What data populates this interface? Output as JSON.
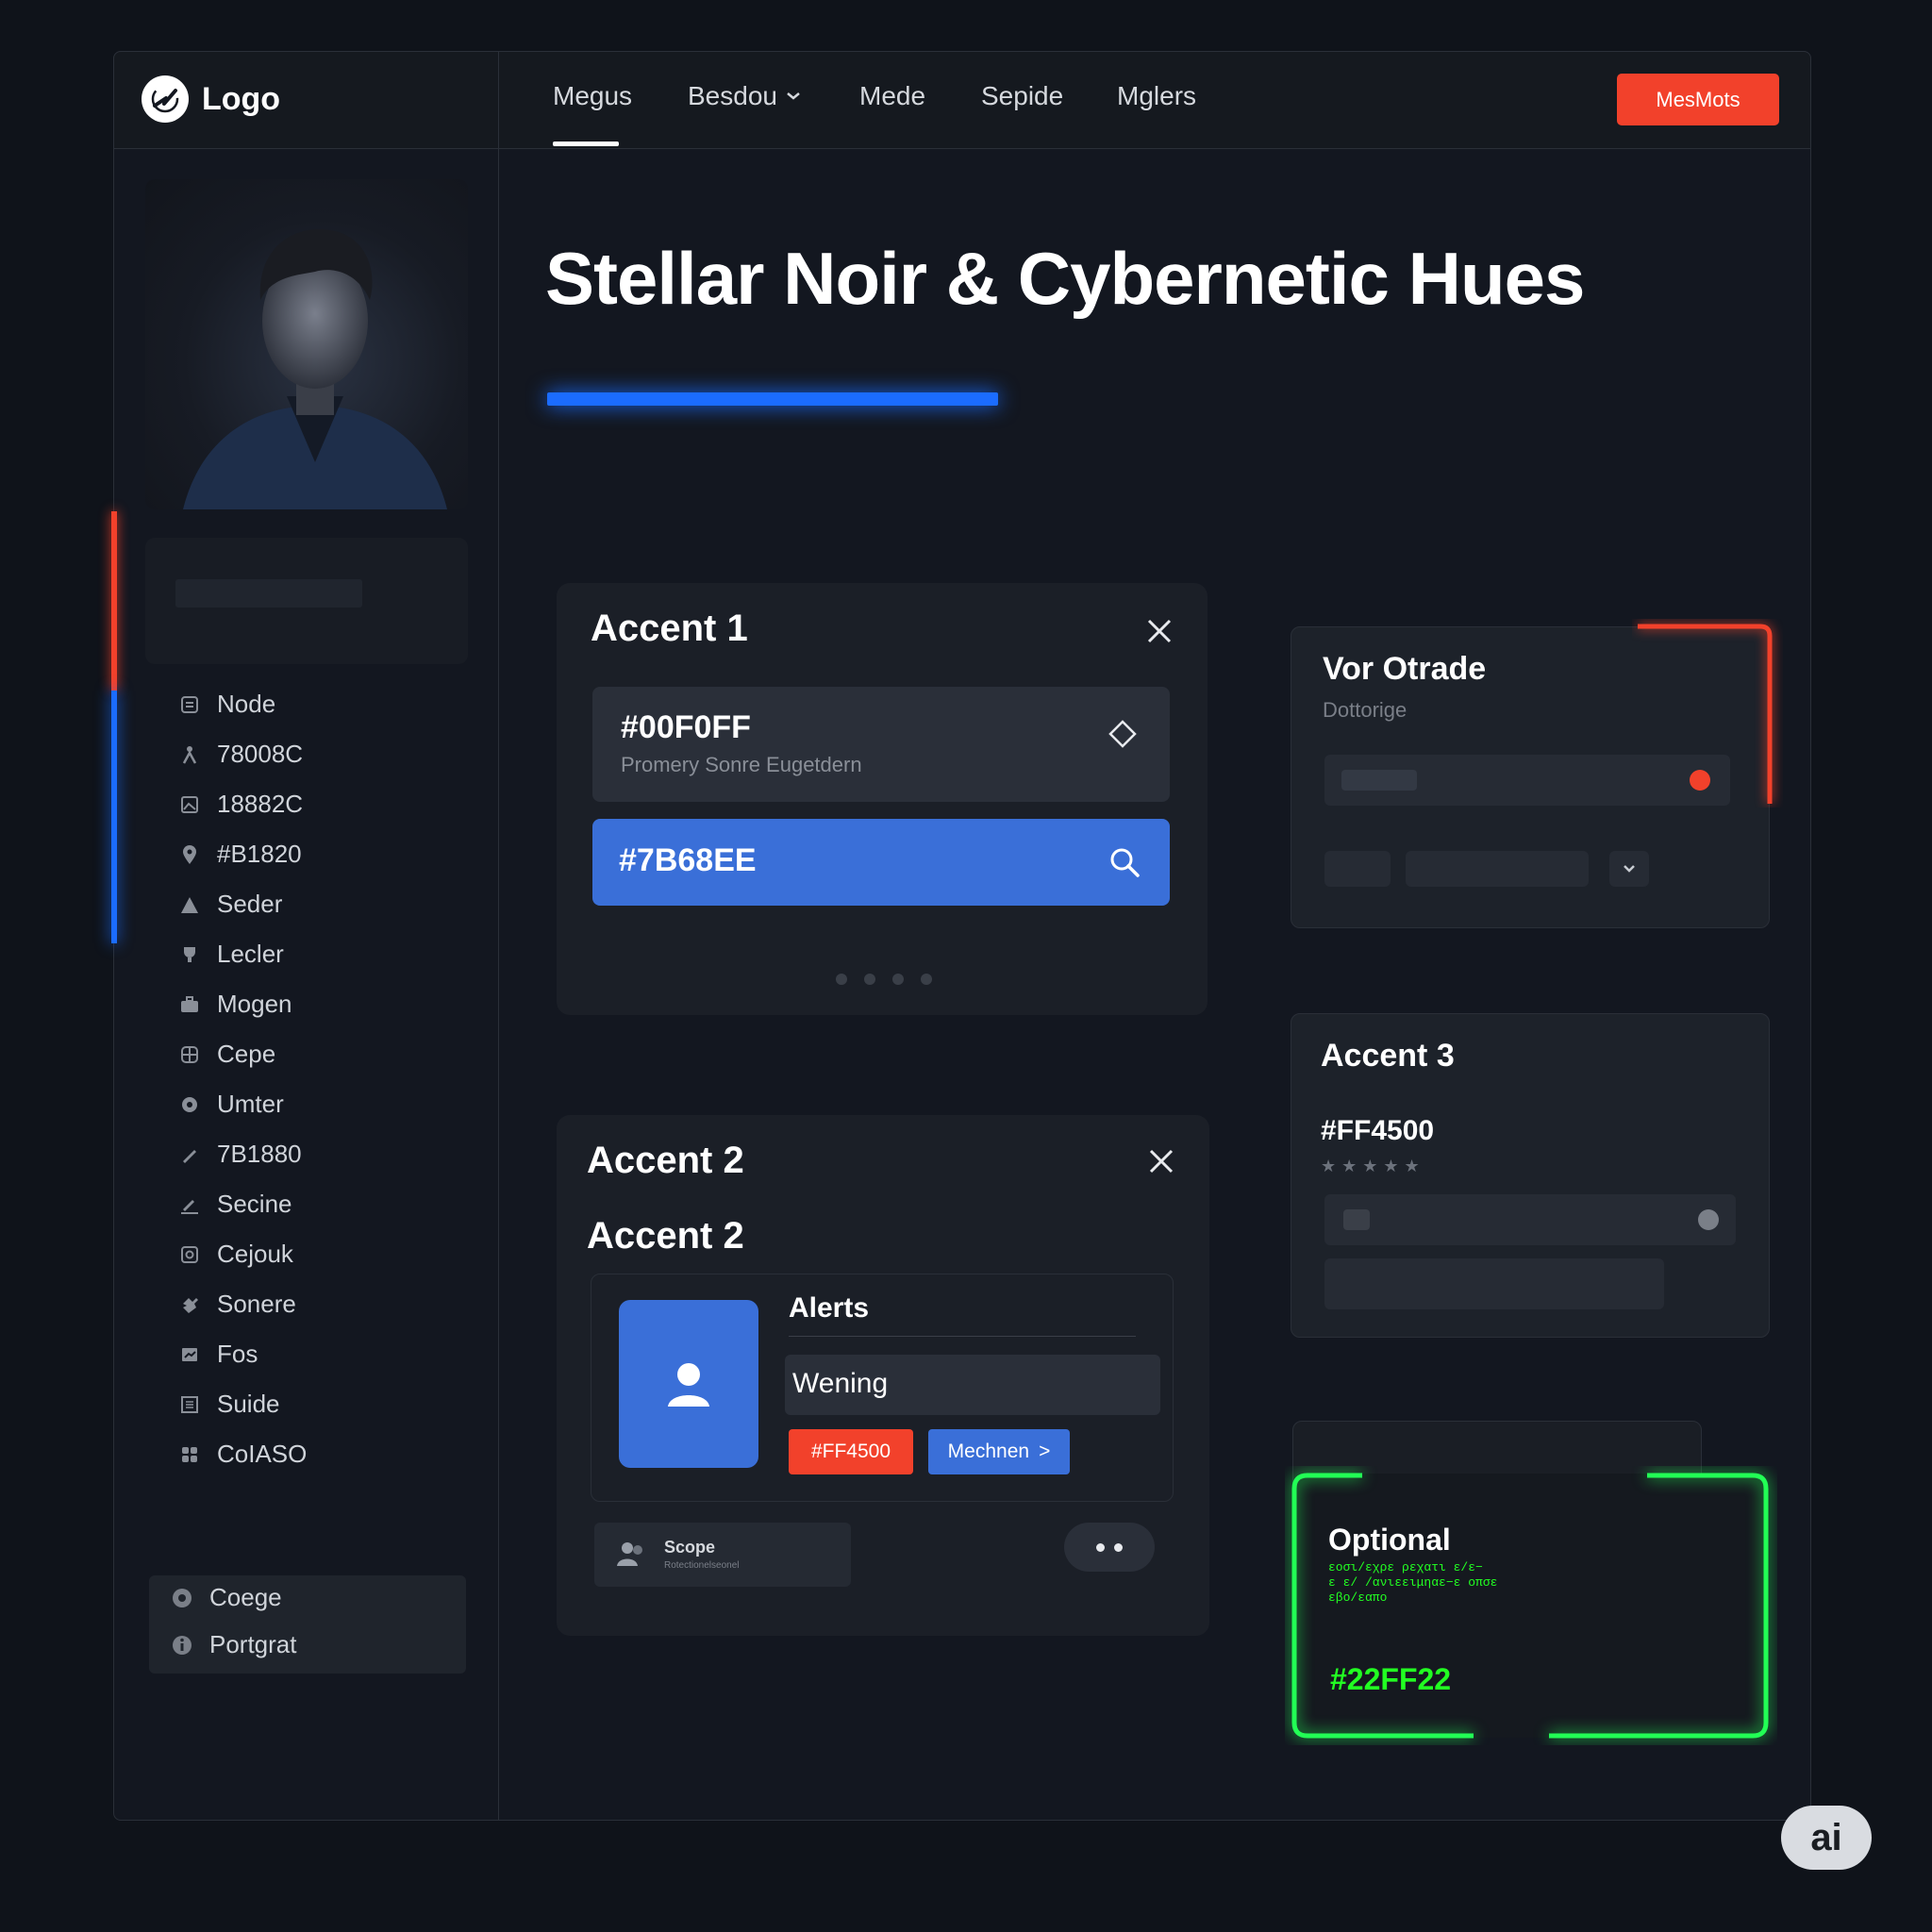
{
  "app": {
    "logo_text": "Logo",
    "watermark": "ai"
  },
  "nav": {
    "items": [
      "Megus",
      "Besdou",
      "Mede",
      "Sepide",
      "Mglers"
    ],
    "cta_label": "MesMots"
  },
  "sidebar": {
    "items": [
      {
        "label": "Node",
        "icon": "layers-icon"
      },
      {
        "label": "78008C",
        "icon": "figure-icon"
      },
      {
        "label": "18882C",
        "icon": "image-icon"
      },
      {
        "label": "#B1820",
        "icon": "pin-icon"
      },
      {
        "label": "Seder",
        "icon": "triangle-icon"
      },
      {
        "label": "Lecler",
        "icon": "trophy-icon"
      },
      {
        "label": "Mogen",
        "icon": "briefcase-icon"
      },
      {
        "label": "Cepe",
        "icon": "globe-icon"
      },
      {
        "label": "Umter",
        "icon": "shield-icon"
      },
      {
        "label": "7B1880",
        "icon": "pencil-icon"
      },
      {
        "label": "Secine",
        "icon": "edit-icon"
      },
      {
        "label": "Cejouk",
        "icon": "settings-icon"
      },
      {
        "label": "Sonere",
        "icon": "puzzle-icon"
      },
      {
        "label": "Fos",
        "icon": "chart-icon"
      },
      {
        "label": "Suide",
        "icon": "grid-icon"
      },
      {
        "label": "CoIASO",
        "icon": "apps-icon"
      }
    ],
    "footer": [
      {
        "label": "Coege",
        "icon": "cog-icon"
      },
      {
        "label": "Portgrat",
        "icon": "info-icon"
      }
    ]
  },
  "hero": {
    "title": "Stellar Noir & Cybernetic Hues"
  },
  "accent1": {
    "title": "Accent 1",
    "field_value": "#00F0FF",
    "field_sub": "Promery Sonre Eugetdern",
    "search_value": "#7B68EE"
  },
  "vor_card": {
    "title": "Vor Otrade",
    "subtitle": "Dottorige"
  },
  "accent2": {
    "title": "Accent 2",
    "subtitle": "Accent 2",
    "alerts_label": "Alerts",
    "warning_label": "Wening",
    "badge_color_label": "#FF4500",
    "more_button_label": "Mechnen",
    "more_button_chevron": ">",
    "footer_title": "Scope",
    "footer_sub": "Rotectionelseonel"
  },
  "accent3": {
    "title": "Accent 3",
    "color_label": "#FF4500",
    "stars": 5
  },
  "optional": {
    "title": "Optional",
    "code_line1": "εοσι/εχρε  ρεχατι  ε/ε−",
    "code_line2": "ε  ε/ /ανιεειμηαε−ε οπσε",
    "code_line3": "εβο/εαπο",
    "color_label": "#22FF22"
  },
  "colors": {
    "accent_red": "#F2412B",
    "accent_blue": "#1B6CFF",
    "field_blue": "#3A6FD8",
    "accent_green": "#22FF22",
    "background": "#0F131A"
  }
}
